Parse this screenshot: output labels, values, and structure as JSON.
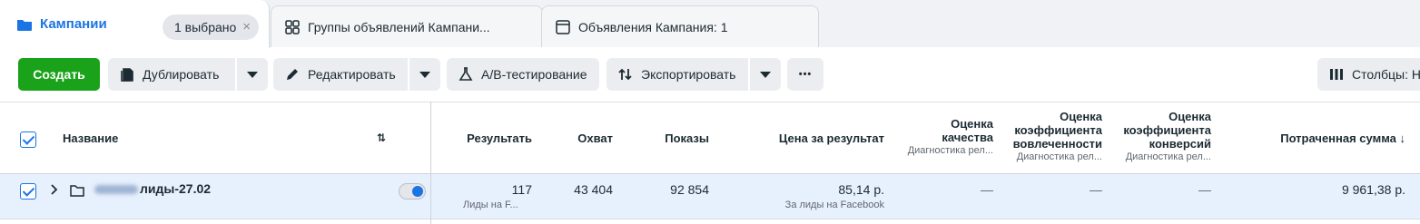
{
  "tabs": {
    "campaigns": {
      "label": "Кампании",
      "selected": "1 выбрано",
      "close": "×"
    },
    "adsets": {
      "label": "Группы объявлений Кампани..."
    },
    "ads": {
      "label": "Объявления Кампания: 1"
    }
  },
  "toolbar": {
    "create": "Создать",
    "duplicate": "Дублировать",
    "edit": "Редактировать",
    "ab_test": "A/B-тестирование",
    "export": "Экспортировать",
    "more": "•••",
    "columns": "Столбцы: На"
  },
  "table": {
    "headers": {
      "name": "Название",
      "results": "Результать",
      "reach": "Охват",
      "impressions": "Показы",
      "cost_per_result": "Цена за результат",
      "quality": {
        "title": "Оценка качества",
        "sub": "Диагностика рел..."
      },
      "engagement": {
        "title": "Оценка коэффициента вовлеченности",
        "sub": "Диагностика рел..."
      },
      "conversion": {
        "title": "Оценка коэффициента конверсий",
        "sub": "Диагностика рел..."
      },
      "spent": "Потраченная сумма ↓"
    },
    "rows": [
      {
        "name": "лиды-27.02",
        "results": "117",
        "results_sub": "Лиды на F...",
        "reach": "43 404",
        "impressions": "92 854",
        "cost_per_result": "85,14 р.",
        "cost_sub": "За лиды на Facebook",
        "quality": "—",
        "engagement": "—",
        "conversion": "—",
        "spent": "9 961,38 р."
      }
    ]
  },
  "colors": {
    "accent": "#1b74e4",
    "create": "#1aa31a",
    "selected_row": "#e7f0fd"
  }
}
